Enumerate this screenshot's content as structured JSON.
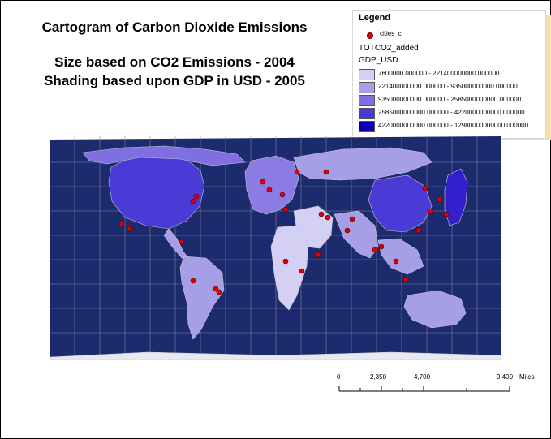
{
  "title": {
    "line1": "Cartogram of Carbon Dioxide Emissions",
    "line2": "Size based on CO2 Emissions - 2004",
    "line3": "Shading based upon GDP in USD - 2005"
  },
  "legend": {
    "title": "Legend",
    "cities_label": "cities_c",
    "layer_name": "TOTCO2_added",
    "field_name": "GDP_USD",
    "classes": [
      {
        "label": "7600000.000000 - 221400000000.000000",
        "color": "#d4d0f4"
      },
      {
        "label": "221400000000.000000 - 935000000000.000000",
        "color": "#a79ee8"
      },
      {
        "label": "935000000000.000000 - 2585000000000.000000",
        "color": "#7f6fe0"
      },
      {
        "label": "2585000000000.000000 - 4220000000000.000000",
        "color": "#4c38d8"
      },
      {
        "label": "4220000000000.000000 - 12980000000000.000000",
        "color": "#0a00b0"
      }
    ]
  },
  "colors": {
    "ocean": "#1c2a6e",
    "grid": "#8a8fa8",
    "city": "#e00000",
    "legend_shadow": "#f7dfb0"
  },
  "scale_bar": {
    "ticks": [
      "0",
      "2,350",
      "4,700",
      "9,400"
    ],
    "unit": "Miles"
  }
}
